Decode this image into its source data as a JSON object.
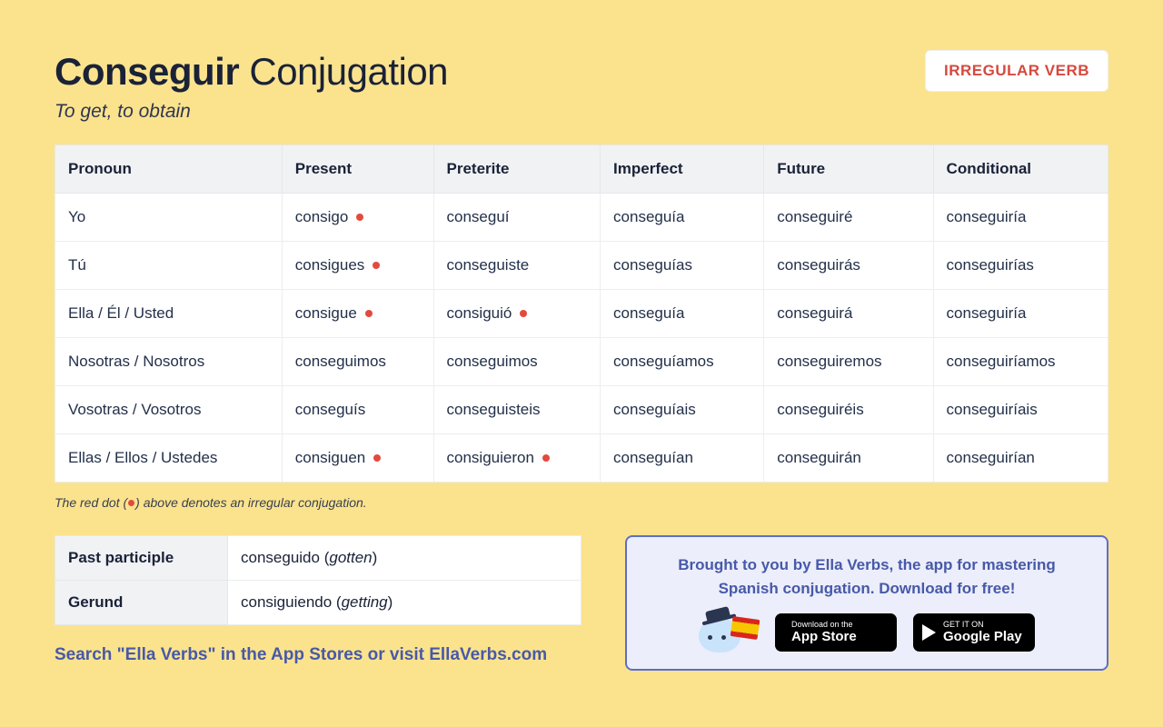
{
  "header": {
    "verb": "Conseguir",
    "title_suffix": "Conjugation",
    "badge": "IRREGULAR VERB",
    "subtitle": "To get, to obtain"
  },
  "table": {
    "columns": [
      "Pronoun",
      "Present",
      "Preterite",
      "Imperfect",
      "Future",
      "Conditional"
    ],
    "rows": [
      {
        "pronoun": "Yo",
        "cells": [
          {
            "text": "consigo",
            "irr": true
          },
          {
            "text": "conseguí",
            "irr": false
          },
          {
            "text": "conseguía",
            "irr": false
          },
          {
            "text": "conseguiré",
            "irr": false
          },
          {
            "text": "conseguiría",
            "irr": false
          }
        ]
      },
      {
        "pronoun": "Tú",
        "cells": [
          {
            "text": "consigues",
            "irr": true
          },
          {
            "text": "conseguiste",
            "irr": false
          },
          {
            "text": "conseguías",
            "irr": false
          },
          {
            "text": "conseguirás",
            "irr": false
          },
          {
            "text": "conseguirías",
            "irr": false
          }
        ]
      },
      {
        "pronoun": "Ella / Él / Usted",
        "cells": [
          {
            "text": "consigue",
            "irr": true
          },
          {
            "text": "consiguió",
            "irr": true
          },
          {
            "text": "conseguía",
            "irr": false
          },
          {
            "text": "conseguirá",
            "irr": false
          },
          {
            "text": "conseguiría",
            "irr": false
          }
        ]
      },
      {
        "pronoun": "Nosotras / Nosotros",
        "cells": [
          {
            "text": "conseguimos",
            "irr": false
          },
          {
            "text": "conseguimos",
            "irr": false
          },
          {
            "text": "conseguíamos",
            "irr": false
          },
          {
            "text": "conseguiremos",
            "irr": false
          },
          {
            "text": "conseguiríamos",
            "irr": false
          }
        ]
      },
      {
        "pronoun": "Vosotras / Vosotros",
        "cells": [
          {
            "text": "conseguís",
            "irr": false
          },
          {
            "text": "conseguisteis",
            "irr": false
          },
          {
            "text": "conseguíais",
            "irr": false
          },
          {
            "text": "conseguiréis",
            "irr": false
          },
          {
            "text": "conseguiríais",
            "irr": false
          }
        ]
      },
      {
        "pronoun": "Ellas / Ellos / Ustedes",
        "cells": [
          {
            "text": "consiguen",
            "irr": true
          },
          {
            "text": "consiguieron",
            "irr": true
          },
          {
            "text": "conseguían",
            "irr": false
          },
          {
            "text": "conseguirán",
            "irr": false
          },
          {
            "text": "conseguirían",
            "irr": false
          }
        ]
      }
    ]
  },
  "legend": {
    "prefix": "The red dot (",
    "suffix": ") above denotes an irregular conjugation."
  },
  "forms": {
    "past_participle": {
      "label": "Past participle",
      "value": "conseguido",
      "gloss": "gotten"
    },
    "gerund": {
      "label": "Gerund",
      "value": "consiguiendo",
      "gloss": "getting"
    }
  },
  "search_line": "Search \"Ella Verbs\" in the App Stores or visit EllaVerbs.com",
  "promo": {
    "text": "Brought to you by Ella Verbs, the app for mastering Spanish conjugation. Download for free!",
    "appstore": {
      "small": "Download on the",
      "big": "App Store"
    },
    "gplay": {
      "small": "GET IT ON",
      "big": "Google Play"
    }
  }
}
